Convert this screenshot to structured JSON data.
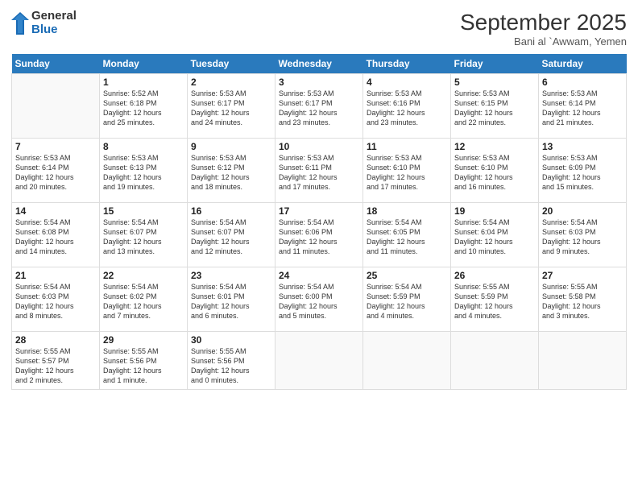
{
  "logo": {
    "general": "General",
    "blue": "Blue"
  },
  "title": "September 2025",
  "subtitle": "Bani al `Awwam, Yemen",
  "days": [
    "Sunday",
    "Monday",
    "Tuesday",
    "Wednesday",
    "Thursday",
    "Friday",
    "Saturday"
  ],
  "weeks": [
    [
      {
        "day": "",
        "content": ""
      },
      {
        "day": "1",
        "content": "Sunrise: 5:52 AM\nSunset: 6:18 PM\nDaylight: 12 hours\nand 25 minutes."
      },
      {
        "day": "2",
        "content": "Sunrise: 5:53 AM\nSunset: 6:17 PM\nDaylight: 12 hours\nand 24 minutes."
      },
      {
        "day": "3",
        "content": "Sunrise: 5:53 AM\nSunset: 6:17 PM\nDaylight: 12 hours\nand 23 minutes."
      },
      {
        "day": "4",
        "content": "Sunrise: 5:53 AM\nSunset: 6:16 PM\nDaylight: 12 hours\nand 23 minutes."
      },
      {
        "day": "5",
        "content": "Sunrise: 5:53 AM\nSunset: 6:15 PM\nDaylight: 12 hours\nand 22 minutes."
      },
      {
        "day": "6",
        "content": "Sunrise: 5:53 AM\nSunset: 6:14 PM\nDaylight: 12 hours\nand 21 minutes."
      }
    ],
    [
      {
        "day": "7",
        "content": "Sunrise: 5:53 AM\nSunset: 6:14 PM\nDaylight: 12 hours\nand 20 minutes."
      },
      {
        "day": "8",
        "content": "Sunrise: 5:53 AM\nSunset: 6:13 PM\nDaylight: 12 hours\nand 19 minutes."
      },
      {
        "day": "9",
        "content": "Sunrise: 5:53 AM\nSunset: 6:12 PM\nDaylight: 12 hours\nand 18 minutes."
      },
      {
        "day": "10",
        "content": "Sunrise: 5:53 AM\nSunset: 6:11 PM\nDaylight: 12 hours\nand 17 minutes."
      },
      {
        "day": "11",
        "content": "Sunrise: 5:53 AM\nSunset: 6:10 PM\nDaylight: 12 hours\nand 17 minutes."
      },
      {
        "day": "12",
        "content": "Sunrise: 5:53 AM\nSunset: 6:10 PM\nDaylight: 12 hours\nand 16 minutes."
      },
      {
        "day": "13",
        "content": "Sunrise: 5:53 AM\nSunset: 6:09 PM\nDaylight: 12 hours\nand 15 minutes."
      }
    ],
    [
      {
        "day": "14",
        "content": "Sunrise: 5:54 AM\nSunset: 6:08 PM\nDaylight: 12 hours\nand 14 minutes."
      },
      {
        "day": "15",
        "content": "Sunrise: 5:54 AM\nSunset: 6:07 PM\nDaylight: 12 hours\nand 13 minutes."
      },
      {
        "day": "16",
        "content": "Sunrise: 5:54 AM\nSunset: 6:07 PM\nDaylight: 12 hours\nand 12 minutes."
      },
      {
        "day": "17",
        "content": "Sunrise: 5:54 AM\nSunset: 6:06 PM\nDaylight: 12 hours\nand 11 minutes."
      },
      {
        "day": "18",
        "content": "Sunrise: 5:54 AM\nSunset: 6:05 PM\nDaylight: 12 hours\nand 11 minutes."
      },
      {
        "day": "19",
        "content": "Sunrise: 5:54 AM\nSunset: 6:04 PM\nDaylight: 12 hours\nand 10 minutes."
      },
      {
        "day": "20",
        "content": "Sunrise: 5:54 AM\nSunset: 6:03 PM\nDaylight: 12 hours\nand 9 minutes."
      }
    ],
    [
      {
        "day": "21",
        "content": "Sunrise: 5:54 AM\nSunset: 6:03 PM\nDaylight: 12 hours\nand 8 minutes."
      },
      {
        "day": "22",
        "content": "Sunrise: 5:54 AM\nSunset: 6:02 PM\nDaylight: 12 hours\nand 7 minutes."
      },
      {
        "day": "23",
        "content": "Sunrise: 5:54 AM\nSunset: 6:01 PM\nDaylight: 12 hours\nand 6 minutes."
      },
      {
        "day": "24",
        "content": "Sunrise: 5:54 AM\nSunset: 6:00 PM\nDaylight: 12 hours\nand 5 minutes."
      },
      {
        "day": "25",
        "content": "Sunrise: 5:54 AM\nSunset: 5:59 PM\nDaylight: 12 hours\nand 4 minutes."
      },
      {
        "day": "26",
        "content": "Sunrise: 5:55 AM\nSunset: 5:59 PM\nDaylight: 12 hours\nand 4 minutes."
      },
      {
        "day": "27",
        "content": "Sunrise: 5:55 AM\nSunset: 5:58 PM\nDaylight: 12 hours\nand 3 minutes."
      }
    ],
    [
      {
        "day": "28",
        "content": "Sunrise: 5:55 AM\nSunset: 5:57 PM\nDaylight: 12 hours\nand 2 minutes."
      },
      {
        "day": "29",
        "content": "Sunrise: 5:55 AM\nSunset: 5:56 PM\nDaylight: 12 hours\nand 1 minute."
      },
      {
        "day": "30",
        "content": "Sunrise: 5:55 AM\nSunset: 5:56 PM\nDaylight: 12 hours\nand 0 minutes."
      },
      {
        "day": "",
        "content": ""
      },
      {
        "day": "",
        "content": ""
      },
      {
        "day": "",
        "content": ""
      },
      {
        "day": "",
        "content": ""
      }
    ]
  ]
}
